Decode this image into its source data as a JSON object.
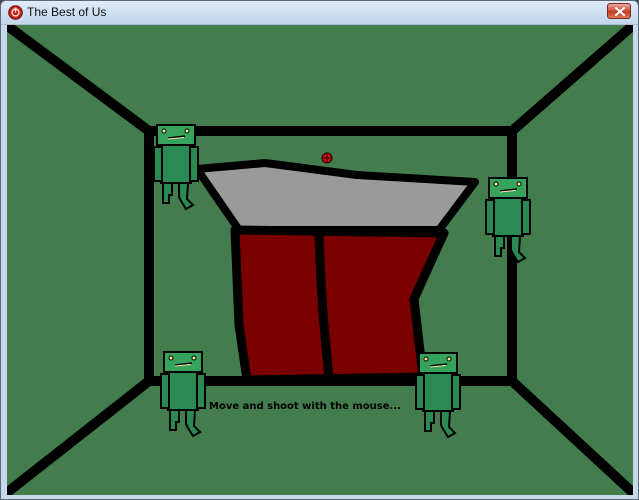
{
  "window": {
    "title": "The Best of Us",
    "close_icon": "close-x-icon",
    "app_icon": "red-round-app-icon"
  },
  "game": {
    "background_color": "#437d4d",
    "instruction": "Move and shoot with the mouse...",
    "door_color": "#7a0000",
    "lid_color": "#9a9a9a",
    "zombie_body_color": "#2b8a52",
    "zombie_head_color": "#35a35c",
    "crosshair_color": "#cc1111",
    "zombies": [
      "zombie-top-left",
      "zombie-right",
      "zombie-bottom-left",
      "zombie-bottom-right"
    ]
  }
}
